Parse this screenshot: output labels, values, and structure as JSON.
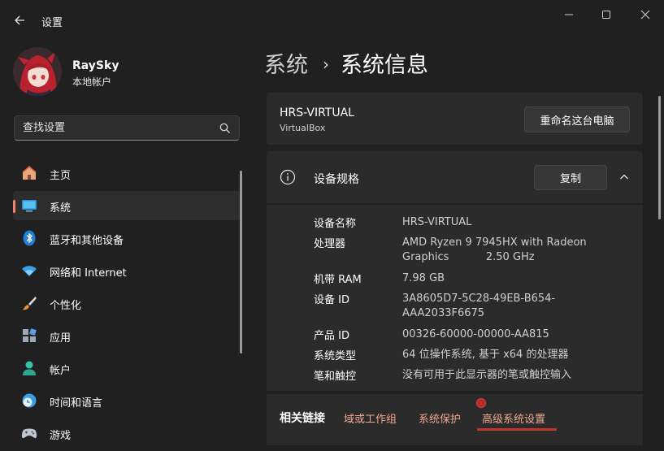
{
  "window": {
    "title": "设置"
  },
  "profile": {
    "name": "RaySky",
    "account_type": "本地帐户"
  },
  "search": {
    "placeholder": "查找设置"
  },
  "sidebar": {
    "items": [
      {
        "label": "主页",
        "icon": "home-icon",
        "active": false
      },
      {
        "label": "系统",
        "icon": "system-icon",
        "active": true
      },
      {
        "label": "蓝牙和其他设备",
        "icon": "bluetooth-icon",
        "active": false
      },
      {
        "label": "网络和 Internet",
        "icon": "wifi-icon",
        "active": false
      },
      {
        "label": "个性化",
        "icon": "brush-icon",
        "active": false
      },
      {
        "label": "应用",
        "icon": "apps-icon",
        "active": false
      },
      {
        "label": "帐户",
        "icon": "account-icon",
        "active": false
      },
      {
        "label": "时间和语言",
        "icon": "clock-globe-icon",
        "active": false
      },
      {
        "label": "游戏",
        "icon": "gamepad-icon",
        "active": false
      }
    ]
  },
  "breadcrumb": {
    "parent": "系统",
    "separator": "›",
    "current": "系统信息"
  },
  "pc": {
    "name": "HRS-VIRTUAL",
    "model": "VirtualBox",
    "rename_label": "重命名这台电脑"
  },
  "specs": {
    "title": "设备规格",
    "copy_label": "复制",
    "rows": [
      {
        "label": "设备名称",
        "value": "HRS-VIRTUAL"
      },
      {
        "label": "处理器",
        "value": "AMD Ryzen 9 7945HX with Radeon Graphics           2.50 GHz"
      },
      {
        "label": "机带 RAM",
        "value": "7.98 GB"
      },
      {
        "label": "设备 ID",
        "value": "3A8605D7-5C28-49EB-B654-AAA2033F6675"
      },
      {
        "label": "产品 ID",
        "value": "00326-60000-00000-AA815"
      },
      {
        "label": "系统类型",
        "value": "64 位操作系统, 基于 x64 的处理器"
      },
      {
        "label": "笔和触控",
        "value": "没有可用于此显示器的笔或触控输入"
      }
    ]
  },
  "related": {
    "title": "相关链接",
    "links": [
      "域或工作组",
      "系统保护",
      "高级系统设置"
    ]
  },
  "colors": {
    "background": "#202020",
    "card": "#2b2b2b",
    "accent": "#f0846e",
    "link": "#f2a890",
    "highlight": "#c0392b"
  }
}
